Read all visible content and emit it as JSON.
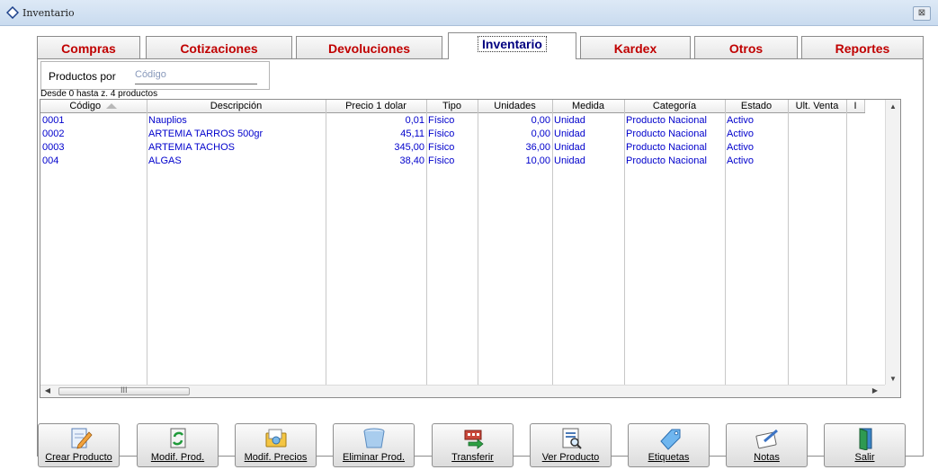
{
  "window": {
    "title": "Inventario",
    "close_glyph": "⊠"
  },
  "tabs": [
    {
      "label": "Compras"
    },
    {
      "label": "Cotizaciones"
    },
    {
      "label": "Devoluciones"
    },
    {
      "label": "Inventario",
      "active": true
    },
    {
      "label": "Kardex"
    },
    {
      "label": "Otros"
    },
    {
      "label": "Reportes"
    }
  ],
  "filter": {
    "label": "Productos por",
    "placeholder": "Código"
  },
  "range_text": "Desde 0 hasta z. 4 productos",
  "table": {
    "columns": [
      "Código",
      "Descripción",
      "Precio 1 dolar",
      "Tipo",
      "Unidades",
      "Medida",
      "Categoría",
      "Estado",
      "Ult. Venta",
      "I"
    ],
    "rows": [
      [
        "0001",
        "Nauplios",
        "0,01",
        "Físico",
        "0,00",
        "Unidad",
        "Producto Nacional",
        "Activo",
        ""
      ],
      [
        "0002",
        "ARTEMIA TARROS 500gr",
        "45,11",
        "Físico",
        "0,00",
        "Unidad",
        "Producto Nacional",
        "Activo",
        ""
      ],
      [
        "0003",
        "ARTEMIA TACHOS",
        "345,00",
        "Físico",
        "36,00",
        "Unidad",
        "Producto Nacional",
        "Activo",
        ""
      ],
      [
        "004",
        "ALGAS",
        "38,40",
        "Físico",
        "10,00",
        "Unidad",
        "Producto Nacional",
        "Activo",
        ""
      ]
    ],
    "hscroll_glyph": "III"
  },
  "buttons": [
    {
      "label": "Crear Producto",
      "icon": "pencil-document-icon"
    },
    {
      "label": "Modif. Prod.",
      "icon": "refresh-document-icon"
    },
    {
      "label": "Modif. Precios",
      "icon": "price-folder-icon"
    },
    {
      "label": "Eliminar Prod.",
      "icon": "trash-bin-icon"
    },
    {
      "label": "Transferir",
      "icon": "transfer-building-icon"
    },
    {
      "label": "Ver Producto",
      "icon": "view-document-icon"
    },
    {
      "label": "Etiquetas",
      "icon": "tag-icon"
    },
    {
      "label": "Notas",
      "icon": "notes-icon"
    },
    {
      "label": "Salir",
      "icon": "exit-door-icon"
    }
  ],
  "colors": {
    "tab_text": "#c00000",
    "active_tab_text": "#000080",
    "row_text": "#0000cc"
  }
}
